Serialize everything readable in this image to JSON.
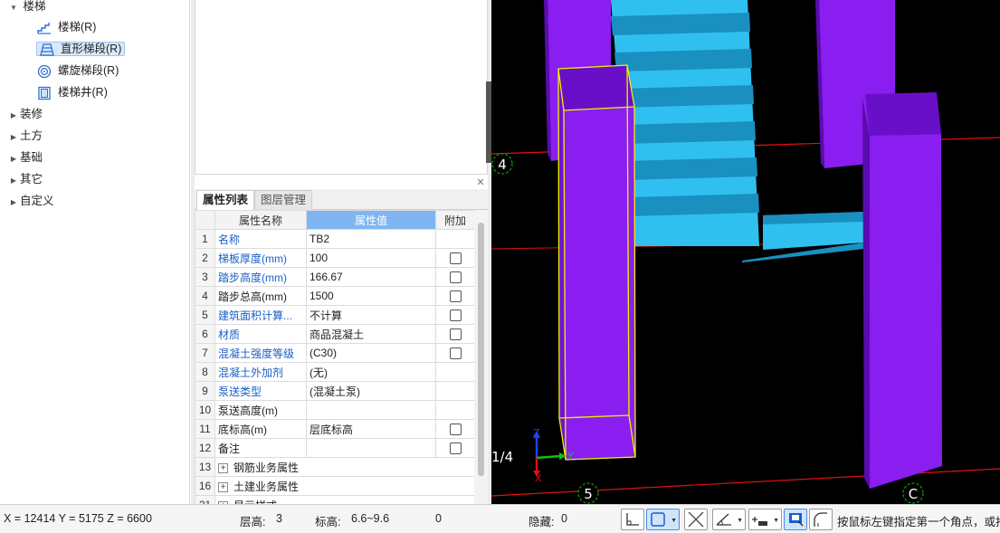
{
  "tree": {
    "root_label": "楼梯",
    "children": [
      {
        "label": "楼梯(R)",
        "icon": "stair-icon"
      },
      {
        "label": "直形梯段(R)",
        "icon": "straight-flight-icon",
        "selected": true
      },
      {
        "label": "螺旋梯段(R)",
        "icon": "spiral-flight-icon"
      },
      {
        "label": "楼梯井(R)",
        "icon": "stairwell-icon"
      }
    ],
    "groups": [
      "装修",
      "土方",
      "基础",
      "其它",
      "自定义"
    ]
  },
  "panel": {
    "tabs": [
      "属性列表",
      "图层管理"
    ],
    "headers": {
      "name": "属性名称",
      "value": "属性值",
      "extra": "附加"
    },
    "rows": [
      {
        "num": "1",
        "name": "名称",
        "value": "TB2",
        "blue": true,
        "checkbox": false
      },
      {
        "num": "2",
        "name": "梯板厚度(mm)",
        "value": "100",
        "blue": true,
        "checkbox": true
      },
      {
        "num": "3",
        "name": "踏步高度(mm)",
        "value": "166.67",
        "blue": true,
        "checkbox": true
      },
      {
        "num": "4",
        "name": "踏步总高(mm)",
        "value": "1500",
        "blue": false,
        "checkbox": true
      },
      {
        "num": "5",
        "name": "建筑面积计算...",
        "value": "不计算",
        "blue": true,
        "checkbox": true
      },
      {
        "num": "6",
        "name": "材质",
        "value": "商品混凝土",
        "blue": true,
        "checkbox": true
      },
      {
        "num": "7",
        "name": "混凝土强度等级",
        "value": "(C30)",
        "blue": true,
        "checkbox": true
      },
      {
        "num": "8",
        "name": "混凝土外加剂",
        "value": "(无)",
        "blue": true,
        "checkbox": false
      },
      {
        "num": "9",
        "name": "泵送类型",
        "value": "(混凝土泵)",
        "blue": true,
        "checkbox": false
      },
      {
        "num": "10",
        "name": "泵送高度(m)",
        "value": "",
        "blue": false,
        "checkbox": false
      },
      {
        "num": "11",
        "name": "底标高(m)",
        "value": "层底标高",
        "blue": false,
        "checkbox": true
      },
      {
        "num": "12",
        "name": "备注",
        "value": "",
        "blue": false,
        "checkbox": true
      },
      {
        "num": "13",
        "name": "钢筋业务属性",
        "value": "",
        "blue": false,
        "checkbox": false,
        "group": true
      },
      {
        "num": "16",
        "name": "土建业务属性",
        "value": "",
        "blue": false,
        "checkbox": false,
        "group": true
      },
      {
        "num": "21",
        "name": "显示样式",
        "value": "",
        "blue": false,
        "checkbox": false,
        "group": true
      }
    ]
  },
  "viewport": {
    "axis_labels": {
      "a4": "4",
      "a14": "1/4",
      "a5": "5",
      "aC": "C"
    },
    "gizmo": {
      "z": "Z",
      "y": "Y",
      "x": "X"
    },
    "colors": {
      "column": "#8a1ef0",
      "column_top": "#6a0fc8",
      "stair": "#30c0f0",
      "stair_shadow": "#1a90c0",
      "grid_line": "#e01010",
      "selection": "#f0f000",
      "axis_bubble": "#10a010"
    }
  },
  "status": {
    "coords": "X = 12414 Y = 5175 Z = 6600",
    "floor_height_label": "层高:",
    "floor_height": "3",
    "elevation_label": "标高:",
    "elevation": "6.6~9.6",
    "zero": "0",
    "hidden_label": "隐藏:",
    "hidden": "0",
    "hint": "按鼠标左键指定第一个角点，或拾"
  }
}
